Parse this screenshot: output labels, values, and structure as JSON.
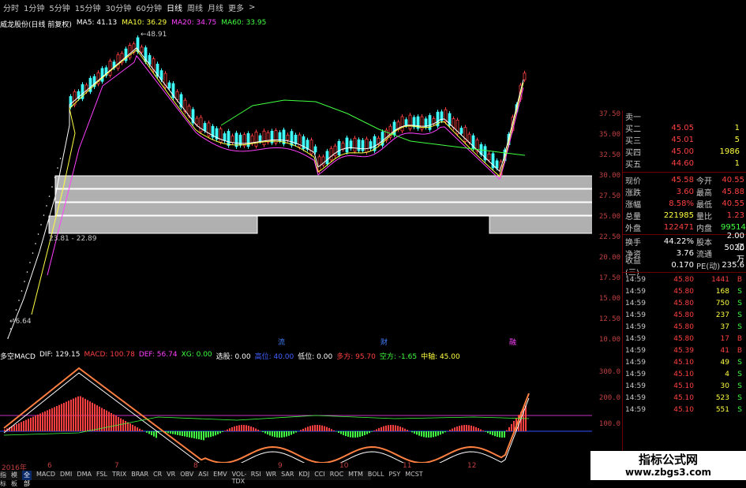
{
  "topbar": {
    "periods": [
      "分时",
      "1分钟",
      "5分钟",
      "15分钟",
      "30分钟",
      "60分钟",
      "日线",
      "周线",
      "月线",
      "更多"
    ],
    "active_period": "日线",
    "more_arrow": ">"
  },
  "infobar": {
    "stock": "威龙股份(日线 前复权)",
    "ma5": "MA5: 41.13",
    "ma10": "MA10: 36.29",
    "ma20": "MA20: 34.75",
    "ma60": "MA60: 33.95"
  },
  "annotations": {
    "high": "48.91",
    "range": "23.81 - 22.89",
    "low": "6.64",
    "markers": [
      "流",
      "财",
      "融"
    ]
  },
  "axis_main": [
    "37.50",
    "35.00",
    "32.50",
    "30.00",
    "27.50",
    "25.00",
    "22.50",
    "20.00",
    "17.50",
    "15.00",
    "12.50",
    "10.00"
  ],
  "indicator_bar": {
    "name": "多空MACD",
    "dif": "DIF: 129.15",
    "macd": "MACD: 100.78",
    "def": "DEF: 56.74",
    "xg": "XG: 0.00",
    "xuangu": "选股: 0.00",
    "gaowei": "高位: 40.00",
    "diwei": "低位: 0.00",
    "duofang": "多方: 95.70",
    "kongfang": "空方: -1.65",
    "zhongzhou": "中轴: 45.00"
  },
  "axis_macd": [
    "300.0",
    "200.0",
    "100.0"
  ],
  "xaxis": [
    "2016年",
    "6",
    "7",
    "8",
    "9",
    "10",
    "11",
    "12"
  ],
  "bottom_tabs": [
    "指标",
    "模板",
    "全部",
    "MACD",
    "DMI",
    "DMA",
    "FSL",
    "TRIX",
    "BRAR",
    "CR",
    "VR",
    "OBV",
    "ASI",
    "EMV",
    "VOL-TDX",
    "RSI",
    "WR",
    "SAR",
    "KDJ",
    "CCI",
    "ROC",
    "MTM",
    "BOLL",
    "PSY",
    "MCST"
  ],
  "active_tab": "全部",
  "order_book": [
    {
      "label": "卖一",
      "price": "",
      "vol": ""
    },
    {
      "label": "买二",
      "price": "45.05",
      "vol": "1"
    },
    {
      "label": "买三",
      "price": "45.01",
      "vol": "5"
    },
    {
      "label": "买四",
      "price": "45.00",
      "vol": "1986"
    },
    {
      "label": "买五",
      "price": "44.60",
      "vol": "1"
    }
  ],
  "quote": [
    {
      "l1": "现价",
      "v1": "45.58",
      "l2": "今开",
      "v2": "40.55"
    },
    {
      "l1": "涨跌",
      "v1": "3.60",
      "l2": "最高",
      "v2": "45.88"
    },
    {
      "l1": "涨幅",
      "v1": "8.58%",
      "l2": "最低",
      "v2": "40.55"
    },
    {
      "l1": "总量",
      "v1": "221985",
      "l2": "量比",
      "v2": "1.23"
    },
    {
      "l1": "外盘",
      "v1": "122471",
      "l2": "内盘",
      "v2": "99514"
    },
    {
      "l1": "换手",
      "v1": "44.22%",
      "l2": "股本",
      "v2": "2.00亿"
    },
    {
      "l1": "净资",
      "v1": "3.76",
      "l2": "流通",
      "v2": "5020万"
    },
    {
      "l1": "收益(三)",
      "v1": "0.170",
      "l2": "PE(动)",
      "v2": "235.6"
    }
  ],
  "ticks": [
    {
      "t": "14:59",
      "p": "45.80",
      "v": "1441",
      "d": "B"
    },
    {
      "t": "14:59",
      "p": "45.80",
      "v": "168",
      "d": "S"
    },
    {
      "t": "14:59",
      "p": "45.80",
      "v": "750",
      "d": "S"
    },
    {
      "t": "14:59",
      "p": "45.80",
      "v": "237",
      "d": "S"
    },
    {
      "t": "14:59",
      "p": "45.80",
      "v": "37",
      "d": "S"
    },
    {
      "t": "14:59",
      "p": "45.80",
      "v": "17",
      "d": "B"
    },
    {
      "t": "14:59",
      "p": "45.39",
      "v": "41",
      "d": "B"
    },
    {
      "t": "14:59",
      "p": "45.10",
      "v": "49",
      "d": "S"
    },
    {
      "t": "14:59",
      "p": "45.10",
      "v": "4",
      "d": "S"
    },
    {
      "t": "14:59",
      "p": "45.10",
      "v": "30",
      "d": "S"
    },
    {
      "t": "14:59",
      "p": "45.10",
      "v": "523",
      "d": "S"
    },
    {
      "t": "14:59",
      "p": "45.10",
      "v": "551",
      "d": "S"
    }
  ],
  "watermark": {
    "line1": "指标公式网",
    "line2": "www.zbgs3.com"
  },
  "colors": {
    "up": "#ff4040",
    "down": "#40ffff",
    "ma5": "#ffffff",
    "ma10": "#ffff40",
    "ma20": "#ff40ff",
    "ma60": "#40ff40",
    "grid": "#6a0000"
  }
}
